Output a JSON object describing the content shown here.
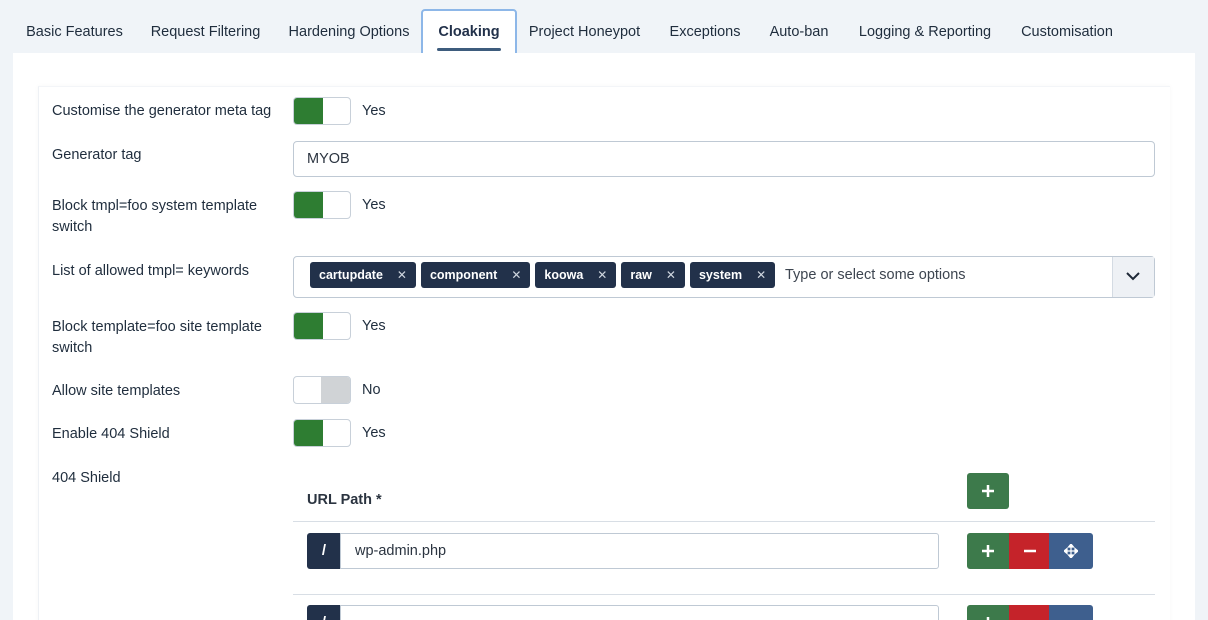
{
  "tabs": [
    {
      "label": "Basic Features"
    },
    {
      "label": "Request Filtering"
    },
    {
      "label": "Hardening Options"
    },
    {
      "label": "Cloaking"
    },
    {
      "label": "Project Honeypot"
    },
    {
      "label": "Exceptions"
    },
    {
      "label": "Auto-ban"
    },
    {
      "label": "Logging & Reporting"
    },
    {
      "label": "Customisation"
    }
  ],
  "active_tab": "Cloaking",
  "fields": {
    "generator_meta": {
      "label": "Customise the generator meta tag",
      "state": "Yes"
    },
    "generator_tag": {
      "label": "Generator tag",
      "value": "MYOB"
    },
    "block_tmpl": {
      "label": "Block tmpl=foo system template switch",
      "state": "Yes"
    },
    "allowed_keywords": {
      "label": "List of allowed tmpl= keywords",
      "chips": [
        "cartupdate",
        "component",
        "koowa",
        "raw",
        "system"
      ],
      "placeholder": "Type or select some options"
    },
    "block_template": {
      "label": "Block template=foo site template switch",
      "state": "Yes"
    },
    "allow_site_templates": {
      "label": "Allow site templates",
      "state": "No"
    },
    "enable_404": {
      "label": "Enable 404 Shield",
      "state": "Yes"
    },
    "shield_404": {
      "label": "404 Shield",
      "column_header": "URL Path *",
      "prefix": "/",
      "rows": [
        {
          "value": "wp-admin.php"
        },
        {
          "value": ""
        }
      ]
    }
  },
  "colors": {
    "toggle_on": "#2e7d32",
    "toggle_off": "#d0d3d6",
    "chip": "#22314a",
    "add": "#3d7a4b",
    "remove": "#c5232a",
    "move": "#3e5f8e"
  },
  "icons": {
    "add": "plus-icon",
    "remove": "minus-icon",
    "move": "move-arrows-icon",
    "dropdown": "chevron-down-icon",
    "chip_remove": "close-icon"
  }
}
